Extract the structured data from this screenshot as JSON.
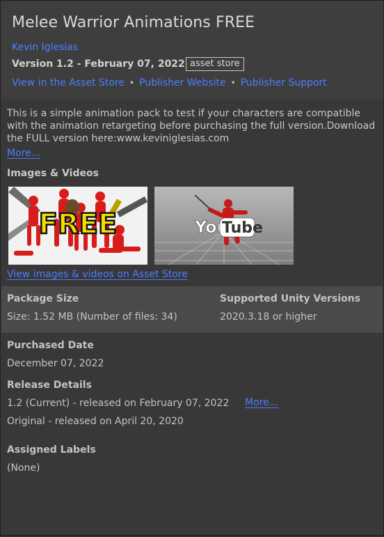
{
  "header": {
    "title": "Melee Warrior Animations FREE",
    "author": "Kevin Iglesias",
    "version": "Version 1.2 - February 07, 2022",
    "tag": "asset store",
    "links": [
      "View in the Asset Store",
      "Publisher Website",
      "Publisher Support"
    ],
    "separator": "•"
  },
  "description": {
    "text": "This is a simple animation pack to test if your characters are compatible with the animation retargeting before purchasing the full version.Download the FULL version here:www.keviniglesias.com",
    "more": "More..."
  },
  "media": {
    "label": "Images & Videos",
    "thumb1_text": "FREE",
    "thumb2_text_you": "You",
    "thumb2_text_tube": "Tube",
    "store_link": "View images & videos on Asset Store"
  },
  "package": {
    "size_label": "Package Size",
    "size_value": "Size: 1.52 MB (Number of files: 34)",
    "unity_label": "Supported Unity Versions",
    "unity_value": "2020.3.18 or higher"
  },
  "purchase": {
    "label": "Purchased Date",
    "value": "December 07, 2022"
  },
  "release": {
    "label": "Release Details",
    "current": "1.2 (Current) - released on February 07, 2022",
    "more": "More...",
    "original": "Original - released on April 20, 2020"
  },
  "labels": {
    "label": "Assigned Labels",
    "value": "(None)"
  },
  "colors": {
    "link": "#4c7eff",
    "background": "#383838",
    "header": "#3e3e3e",
    "band": "#4a4a4a"
  }
}
